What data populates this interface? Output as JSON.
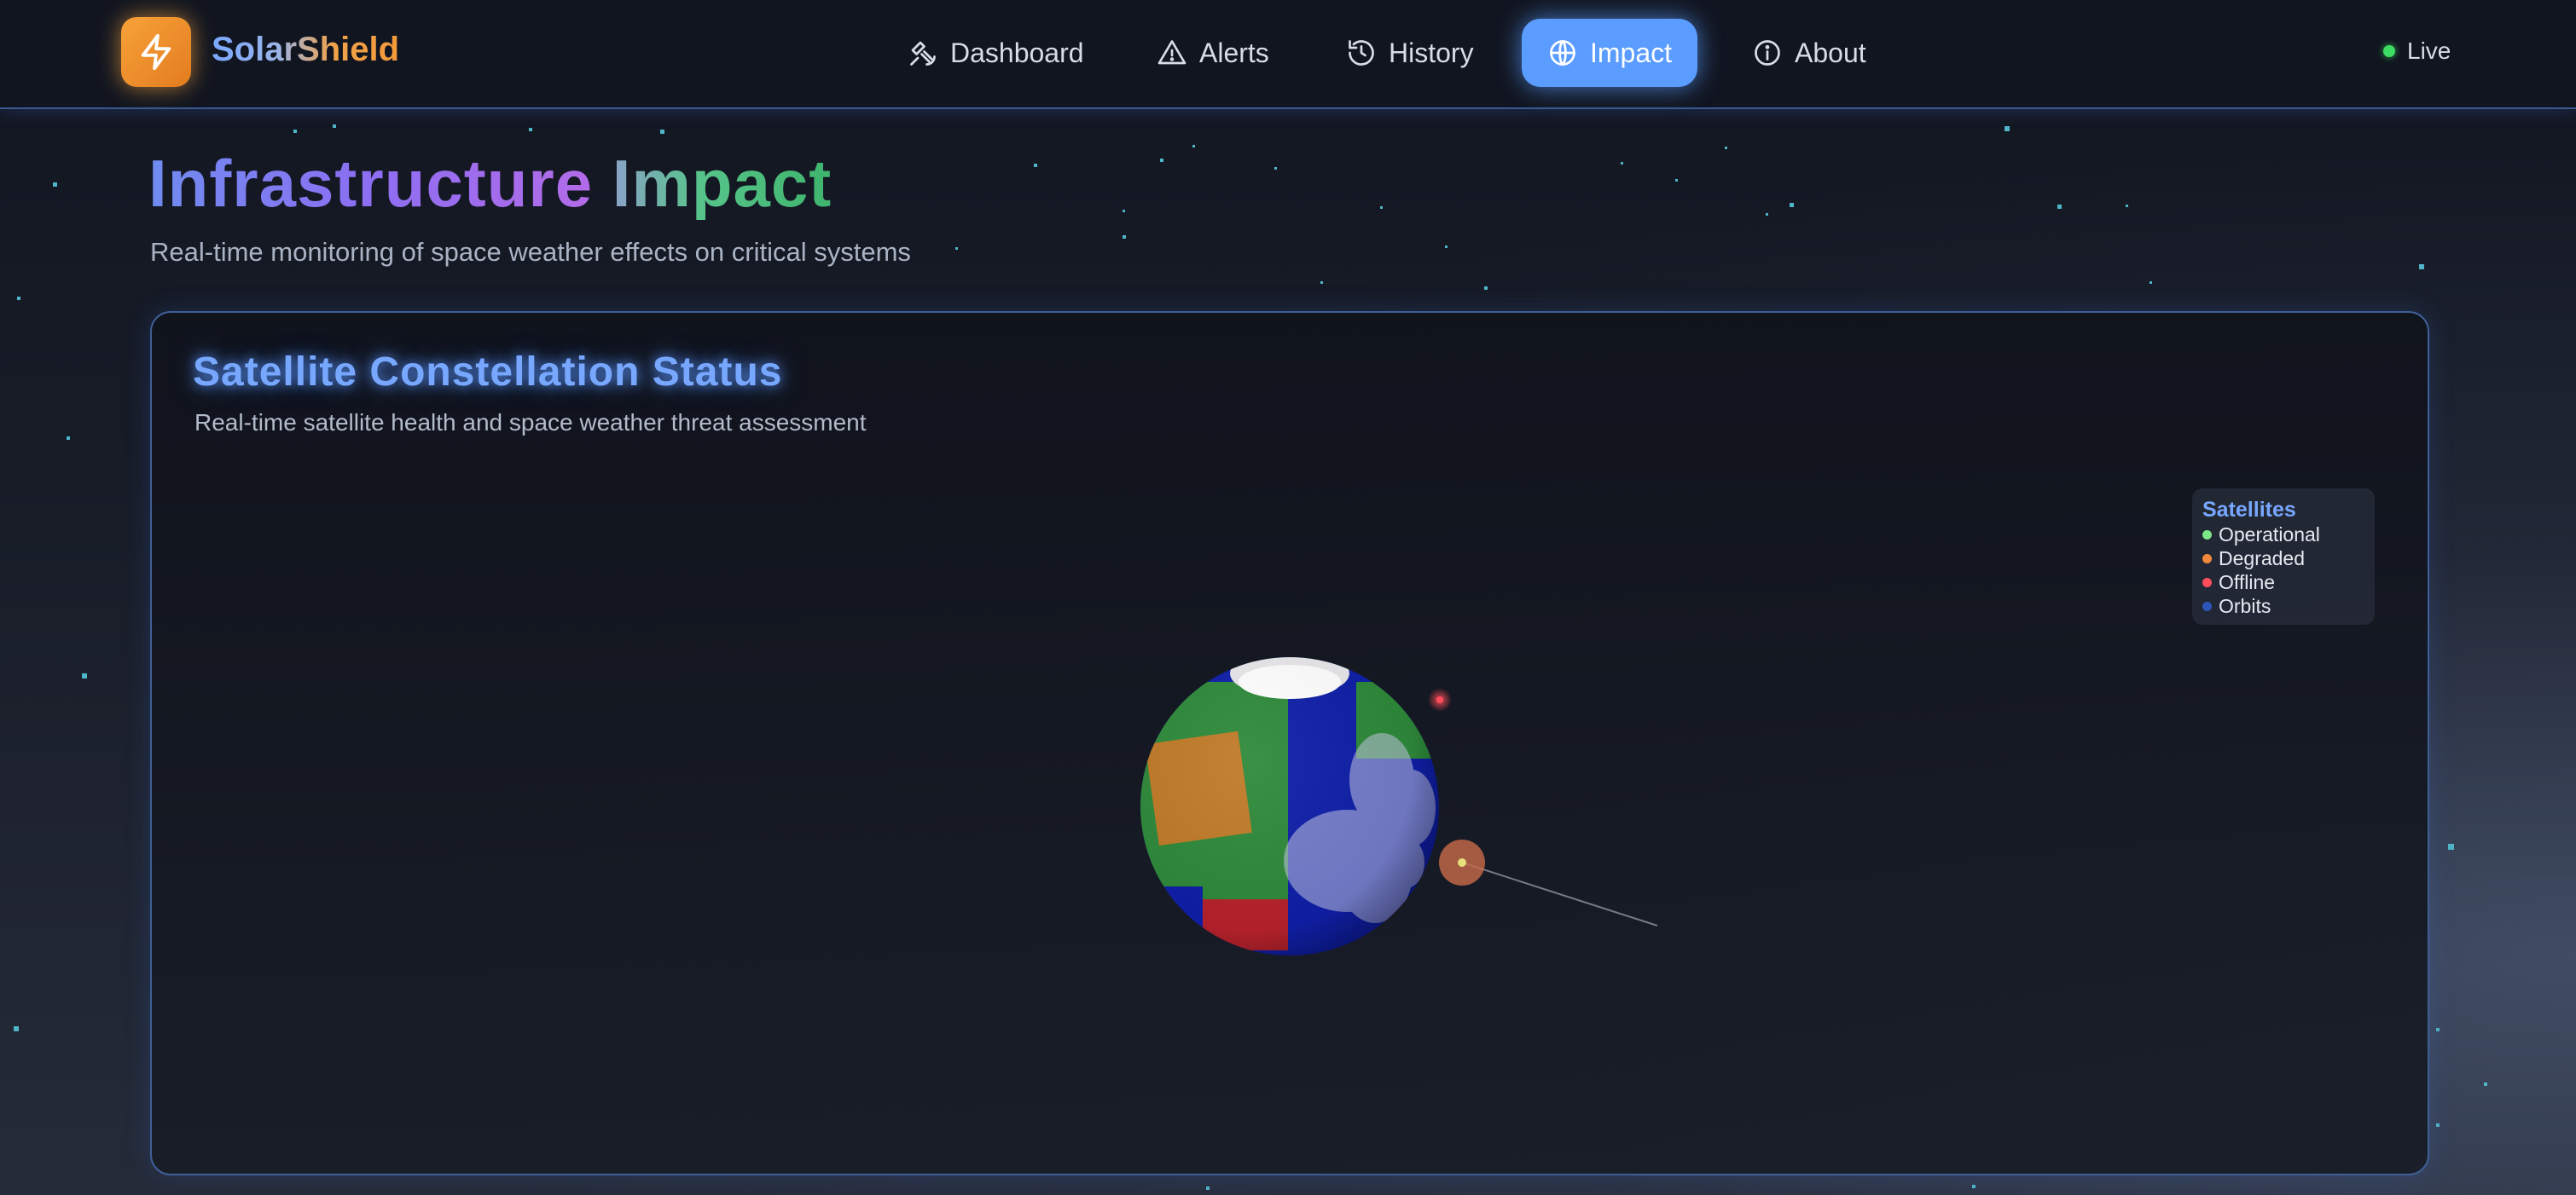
{
  "app": {
    "name": "SolarShield",
    "logo_icon": "lightning-bolt-icon"
  },
  "nav": {
    "items": [
      {
        "label": "Dashboard",
        "icon": "satellite-icon",
        "active": false
      },
      {
        "label": "Alerts",
        "icon": "warning-triangle-icon",
        "active": false
      },
      {
        "label": "History",
        "icon": "history-clock-icon",
        "active": false
      },
      {
        "label": "Impact",
        "icon": "globe-icon",
        "active": true
      },
      {
        "label": "About",
        "icon": "info-icon",
        "active": false
      }
    ],
    "status": {
      "label": "Live",
      "color": "#3ddc62"
    }
  },
  "header": {
    "title_part1": "Infrastructure",
    "title_part2": "Impact",
    "subtitle": "Real-time monitoring of space weather effects on critical systems"
  },
  "panel": {
    "title": "Satellite Constellation Status",
    "subtitle": "Real-time satellite health and space weather threat assessment",
    "legend": {
      "title": "Satellites",
      "items": [
        {
          "label": "Operational",
          "color": "#7ee787"
        },
        {
          "label": "Degraded",
          "color": "#f08a3a"
        },
        {
          "label": "Offline",
          "color": "#ff4d5a"
        },
        {
          "label": "Orbits",
          "color": "#2b56b8"
        }
      ]
    }
  },
  "colors": {
    "accent": "#5a9cff",
    "brand_orange": "#f39a3a",
    "background": "#141822"
  }
}
